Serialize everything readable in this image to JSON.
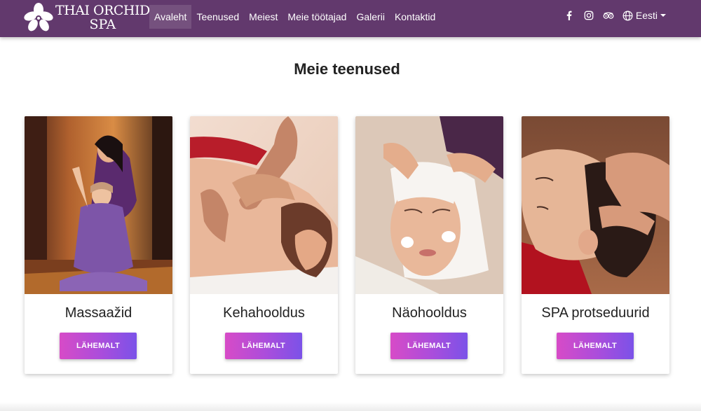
{
  "brand": {
    "line1": "THAI ORCHID",
    "line2": "SPA",
    "logo_icon": "orchid-flower-icon"
  },
  "nav": {
    "items": [
      {
        "label": "Avaleht",
        "active": true
      },
      {
        "label": "Teenused",
        "active": false
      },
      {
        "label": "Meiest",
        "active": false
      },
      {
        "label": "Meie töötajad",
        "active": false
      },
      {
        "label": "Galerii",
        "active": false
      },
      {
        "label": "Kontaktid",
        "active": false
      }
    ],
    "social_icons": [
      "facebook-icon",
      "instagram-icon",
      "tripadvisor-icon"
    ],
    "language": {
      "icon": "globe-icon",
      "label": "Eesti"
    }
  },
  "section": {
    "title": "Meie teenused"
  },
  "cards": [
    {
      "title": "Massaažid",
      "button": "LÄHEMALT"
    },
    {
      "title": "Kehahooldus",
      "button": "LÄHEMALT"
    },
    {
      "title": "Näohooldus",
      "button": "LÄHEMALT"
    },
    {
      "title": "SPA protseduurid",
      "button": "LÄHEMALT"
    }
  ],
  "colors": {
    "navbar": "#62396d",
    "button_start": "#d74bc7",
    "button_end": "#7b52e8"
  }
}
